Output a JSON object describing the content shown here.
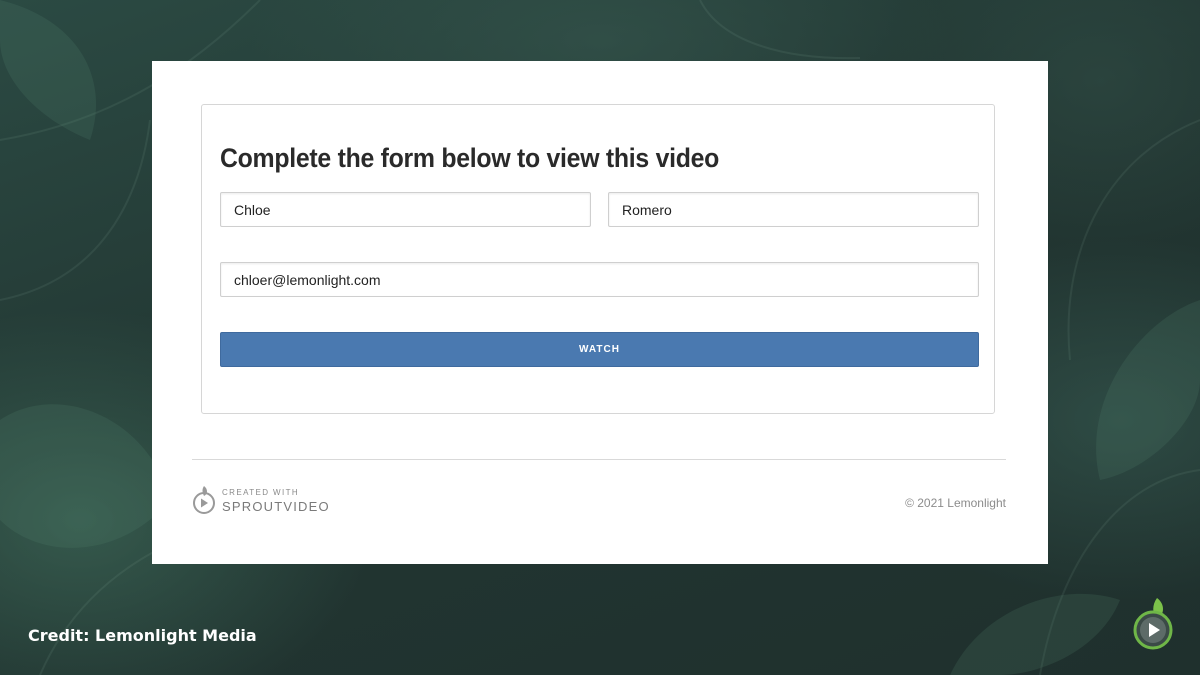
{
  "form": {
    "title": "Complete the form below to view this video",
    "first_name": "Chloe",
    "last_name": "Romero",
    "email": "chloer@lemonlight.com",
    "watch_label": "WATCH",
    "button_color": "#4a79b0"
  },
  "footer": {
    "brand_small": "CREATED WITH",
    "brand_big": "SPROUTVIDEO",
    "copyright": "© 2021 Lemonlight"
  },
  "overlay": {
    "credit": "Credit: Lemonlight Media",
    "corner_icon": "sproutvideo-play-icon"
  },
  "icons": {
    "brand_logo": "sproutvideo-logo-icon",
    "corner_logo": "sproutvideo-play-icon"
  }
}
